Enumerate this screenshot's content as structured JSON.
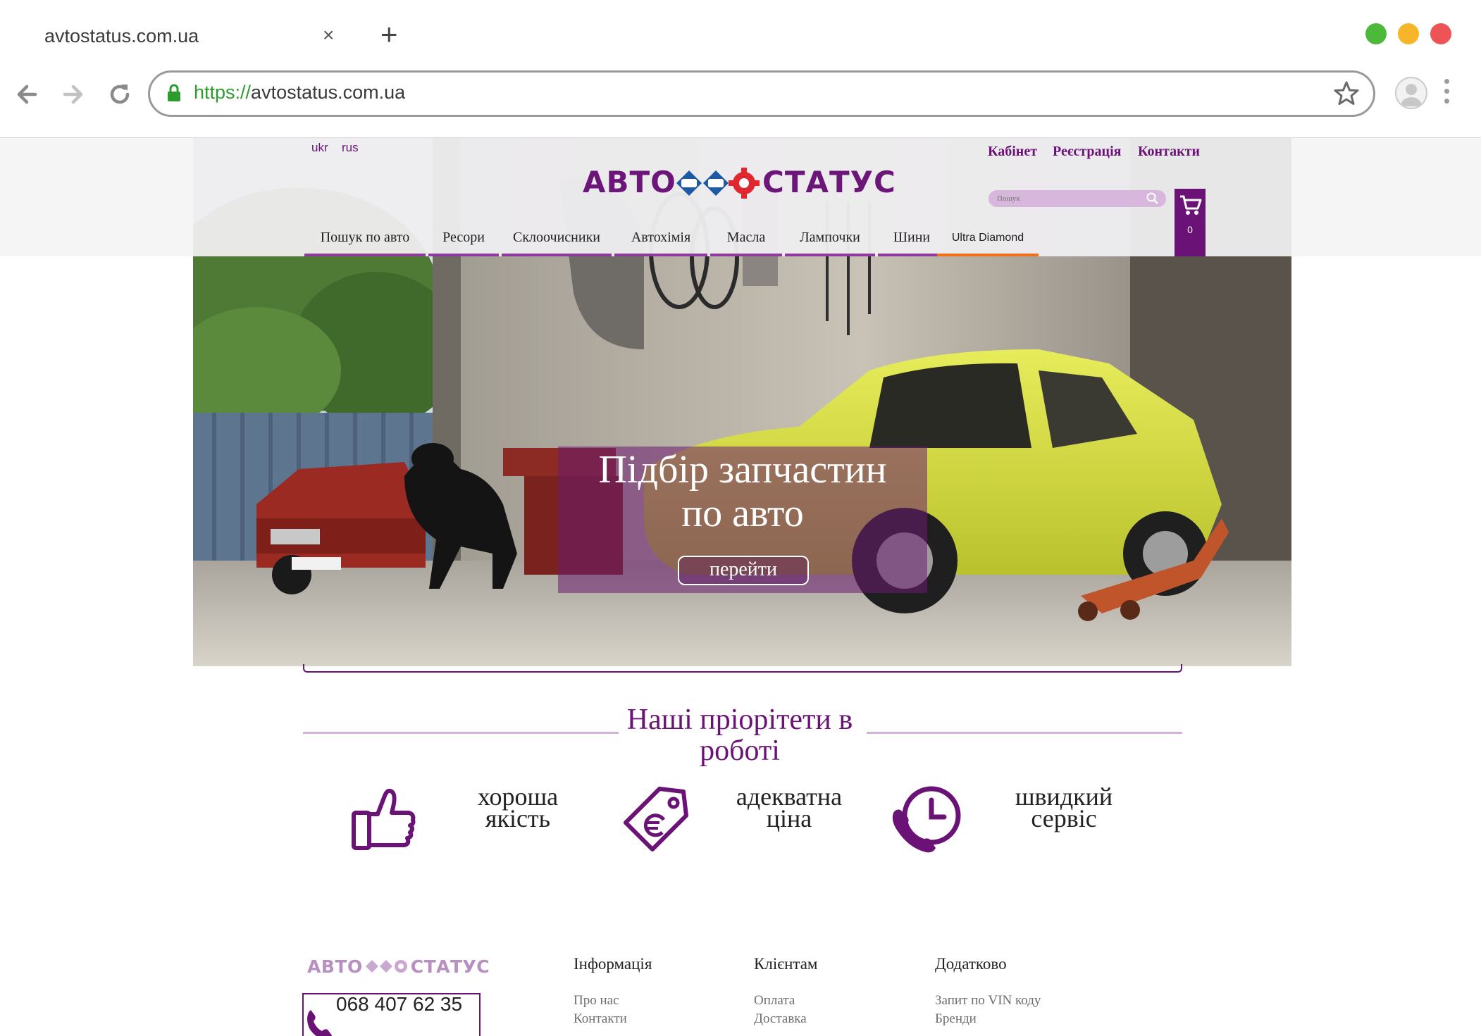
{
  "browser": {
    "tab_title": "avtostatus.com.ua",
    "close_glyph": "×",
    "new_tab_glyph": "+",
    "url_protocol": "https://",
    "url_host": "avtostatus.com.ua",
    "window_dots": [
      "#4cb93b",
      "#f7b529",
      "#ee5355"
    ]
  },
  "header": {
    "lang": [
      "ukr",
      "rus"
    ],
    "top_links": [
      "Кабінет",
      "Реєстрація",
      "Контакти"
    ],
    "logo_left": "АВТО",
    "logo_right": "СТАТУС",
    "search_placeholder": "Пошук",
    "cart_count": "0"
  },
  "nav": [
    "Пошук по авто",
    "Ресори",
    "Склоочисники",
    "Автохімія",
    "Масла",
    "Лампочки",
    "Шини",
    "Ultra Diamond"
  ],
  "hero": {
    "title_line1": "Підбір запчастин",
    "title_line2": "по авто",
    "button": "перейти"
  },
  "priorities": {
    "title_line1": "Наші пріорітети в",
    "title_line2": "роботі",
    "items": [
      {
        "icon": "thumbs-up-icon",
        "line1": "хороша",
        "line2": "якість"
      },
      {
        "icon": "price-tag-euro-icon",
        "line1": "адекватна",
        "line2": "ціна"
      },
      {
        "icon": "phone-clock-icon",
        "line1": "швидкий",
        "line2": "сервіс"
      }
    ]
  },
  "footer": {
    "logo_left": "АВТО",
    "logo_right": "СТАТУС",
    "phone": "068 407 62 35",
    "columns": [
      {
        "title": "Інформація",
        "links": [
          "Про нас",
          "Контакти"
        ]
      },
      {
        "title": "Клієнтам",
        "links": [
          "Оплата",
          "Доставка"
        ]
      },
      {
        "title": "Додатково",
        "links": [
          "Запит по VIN коду",
          "Бренди"
        ]
      }
    ]
  },
  "colors": {
    "brand_purple": "#6b1276",
    "nav_underline": "#8e3b9c",
    "accent_orange": "#f2701c",
    "car_yellow": "#d6e03a"
  }
}
